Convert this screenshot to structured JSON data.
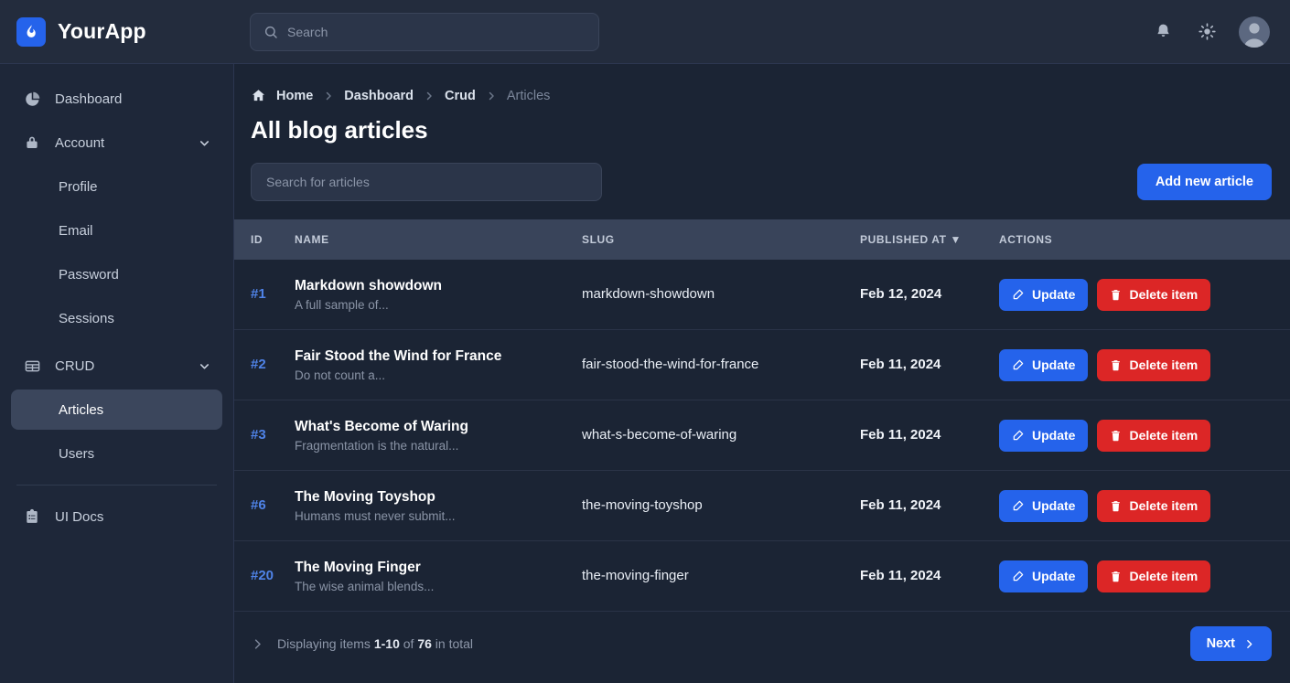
{
  "brand": {
    "name": "YourApp",
    "logo_icon": "flame-icon",
    "logo_color": "#2563eb"
  },
  "header": {
    "search": {
      "placeholder": "Search",
      "value": "",
      "icon": "search-icon"
    },
    "actions": [
      {
        "name": "notifications-button",
        "icon": "bell-icon"
      },
      {
        "name": "theme-toggle-button",
        "icon": "sun-icon"
      },
      {
        "name": "user-avatar",
        "icon": "user-avatar-icon"
      }
    ]
  },
  "sidebar": {
    "items": [
      {
        "label": "Dashboard",
        "icon": "pie-chart-icon",
        "type": "top",
        "active": false
      },
      {
        "label": "Account",
        "icon": "lock-icon",
        "type": "top",
        "expandable": true,
        "active": false
      },
      {
        "label": "Profile",
        "type": "sub",
        "active": false
      },
      {
        "label": "Email",
        "type": "sub",
        "active": false
      },
      {
        "label": "Password",
        "type": "sub",
        "active": false
      },
      {
        "label": "Sessions",
        "type": "sub",
        "active": false
      },
      {
        "label": "CRUD",
        "icon": "table-icon",
        "type": "top",
        "expandable": true,
        "active": false
      },
      {
        "label": "Articles",
        "type": "sub",
        "active": true
      },
      {
        "label": "Users",
        "type": "sub",
        "active": false
      },
      {
        "label": "UI Docs",
        "icon": "clipboard-list-icon",
        "type": "top",
        "active": false
      }
    ]
  },
  "breadcrumb": {
    "home_icon": "home-icon",
    "items": [
      {
        "label": "Home",
        "current": false
      },
      {
        "label": "Dashboard",
        "current": false
      },
      {
        "label": "Crud",
        "current": false
      },
      {
        "label": "Articles",
        "current": true
      }
    ]
  },
  "page": {
    "title": "All blog articles"
  },
  "toolbar": {
    "search": {
      "placeholder": "Search for articles",
      "value": ""
    },
    "add_label": "Add new article"
  },
  "table": {
    "columns": [
      "ID",
      "NAME",
      "SLUG",
      "PUBLISHED AT",
      "ACTIONS"
    ],
    "sort": {
      "column": "PUBLISHED AT",
      "direction": "desc",
      "indicator": "▼"
    },
    "action_labels": {
      "update": "Update",
      "delete": "Delete item"
    },
    "action_icons": {
      "update": "pencil-square-icon",
      "delete": "trash-icon"
    },
    "rows": [
      {
        "id": "#1",
        "name": "Markdown showdown",
        "excerpt": "A full sample of...",
        "slug": "markdown-showdown",
        "published_at": "Feb 12, 2024"
      },
      {
        "id": "#2",
        "name": "Fair Stood the Wind for France",
        "excerpt": "Do not count a...",
        "slug": "fair-stood-the-wind-for-france",
        "published_at": "Feb 11, 2024"
      },
      {
        "id": "#3",
        "name": "What's Become of Waring",
        "excerpt": "Fragmentation is the natural...",
        "slug": "what-s-become-of-waring",
        "published_at": "Feb 11, 2024"
      },
      {
        "id": "#6",
        "name": "The Moving Toyshop",
        "excerpt": "Humans must never submit...",
        "slug": "the-moving-toyshop",
        "published_at": "Feb 11, 2024"
      },
      {
        "id": "#20",
        "name": "The Moving Finger",
        "excerpt": "The wise animal blends...",
        "slug": "the-moving-finger",
        "published_at": "Feb 11, 2024"
      }
    ]
  },
  "footer": {
    "prefix": "Displaying items ",
    "range": "1-10",
    "middle": " of ",
    "total": "76",
    "suffix": " in total",
    "next_label": "Next",
    "next_icon": "chevron-right-icon",
    "left_icon": "chevron-right-icon"
  },
  "colors": {
    "accent": "#2563eb",
    "danger": "#dc2626",
    "page_bg": "#1b2434",
    "sidebar_bg": "#1e2739",
    "topbar_bg": "#232c3d",
    "thead_bg": "#39445a",
    "active_nav_bg": "#3b465c"
  }
}
